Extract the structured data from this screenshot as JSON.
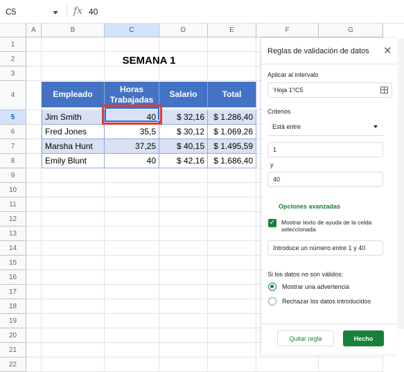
{
  "formula_bar": {
    "cell_ref": "C5",
    "fx": "fx",
    "value": "40"
  },
  "columns": [
    "A",
    "B",
    "C",
    "D",
    "E",
    "F",
    "G"
  ],
  "selected_column": "C",
  "rows": [
    "1",
    "2",
    "3",
    "4",
    "5",
    "6",
    "7",
    "8",
    "9",
    "10",
    "11",
    "12",
    "13",
    "14",
    "15",
    "16",
    "17",
    "18",
    "19",
    "20",
    "21",
    "22"
  ],
  "selected_row": "5",
  "sheet": {
    "title": "SEMANA 1",
    "headers": [
      "Empleado",
      "Horas Trabajadas",
      "Salario",
      "Total"
    ],
    "records": [
      {
        "empleado": "Jim Smith",
        "horas": "40",
        "salario": "$ 32,16",
        "total": "$ 1.286,40"
      },
      {
        "empleado": "Fred Jones",
        "horas": "35,5",
        "salario": "$ 30,12",
        "total": "$ 1.069,26"
      },
      {
        "empleado": "Marsha Hunt",
        "horas": "37,25",
        "salario": "$ 40,15",
        "total": "$ 1.495,59"
      },
      {
        "empleado": "Emily Blunt",
        "horas": "40",
        "salario": "$ 42,16",
        "total": "$ 1.686,40"
      }
    ],
    "header_color": "#4472c4",
    "band_color": "#d9e1f2"
  },
  "panel": {
    "title": "Reglas de validación de datos",
    "close_icon": "close-icon",
    "range_label": "Aplicar al intervalo",
    "range_value": "'Hoja 1'!C5",
    "criteria_label": "Criterios",
    "criteria_value": "Está entre",
    "min_value": "1",
    "and_label": "y",
    "max_value": "40",
    "advanced_label": "Opciones avanzadas",
    "help_checkbox_label": "Mostrar texto de ayuda de la celda seleccionada",
    "help_checked": true,
    "help_text": "Introduce un número entre 1 y 40",
    "invalid_label": "Si los datos no son válidos:",
    "option_warning": "Mostrar una advertencia",
    "option_reject": "Rechazar los datos introducidos",
    "selected_option": "warning",
    "remove_button": "Quitar regla",
    "done_button": "Hecho",
    "accent_color": "#188038"
  }
}
